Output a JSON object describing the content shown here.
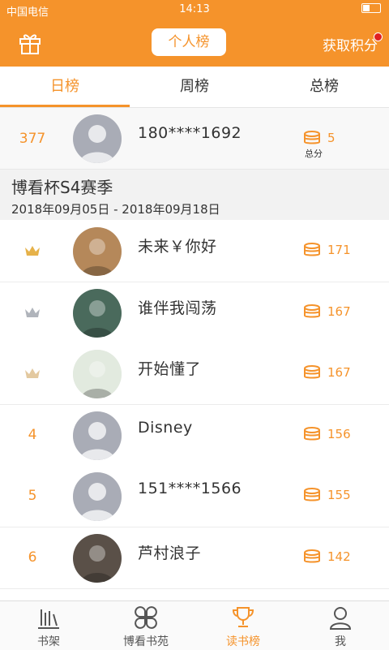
{
  "status": {
    "carrier": "中国电信",
    "signal": "4G",
    "time": "14:13"
  },
  "header": {
    "title": "个人榜",
    "points_label": "获取积分",
    "gift_icon": "gift-icon"
  },
  "tabs": [
    {
      "label": "日榜",
      "active": true
    },
    {
      "label": "周榜",
      "active": false
    },
    {
      "label": "总榜",
      "active": false
    }
  ],
  "me": {
    "rank": "377",
    "name": "180****1692",
    "score": "5",
    "score_label": "总分"
  },
  "season": {
    "title": "博看杯S4赛季",
    "dates": "2018年09月05日 - 2018年09月18日"
  },
  "rows": [
    {
      "rank": "",
      "crown": "gold",
      "name": "未来￥你好",
      "score": "171"
    },
    {
      "rank": "",
      "crown": "silver",
      "name": "谁伴我闯荡",
      "score": "167"
    },
    {
      "rank": "",
      "crown": "bronze",
      "name": "开始懂了",
      "score": "167"
    },
    {
      "rank": "4",
      "crown": "",
      "name": "Disney",
      "score": "156"
    },
    {
      "rank": "5",
      "crown": "",
      "name": "151****1566",
      "score": "155"
    },
    {
      "rank": "6",
      "crown": "",
      "name": "芦村浪子",
      "score": "142"
    }
  ],
  "nav": [
    {
      "label": "书架",
      "icon": "bookshelf-icon",
      "active": false
    },
    {
      "label": "博看书苑",
      "icon": "clover-icon",
      "active": false
    },
    {
      "label": "读书榜",
      "icon": "trophy-icon",
      "active": true
    },
    {
      "label": "我",
      "icon": "user-icon",
      "active": false
    }
  ],
  "colors": {
    "accent": "#f5932b",
    "gold": "#e6b24a",
    "silver": "#b0b4bb",
    "bronze": "#e3c9a0"
  }
}
